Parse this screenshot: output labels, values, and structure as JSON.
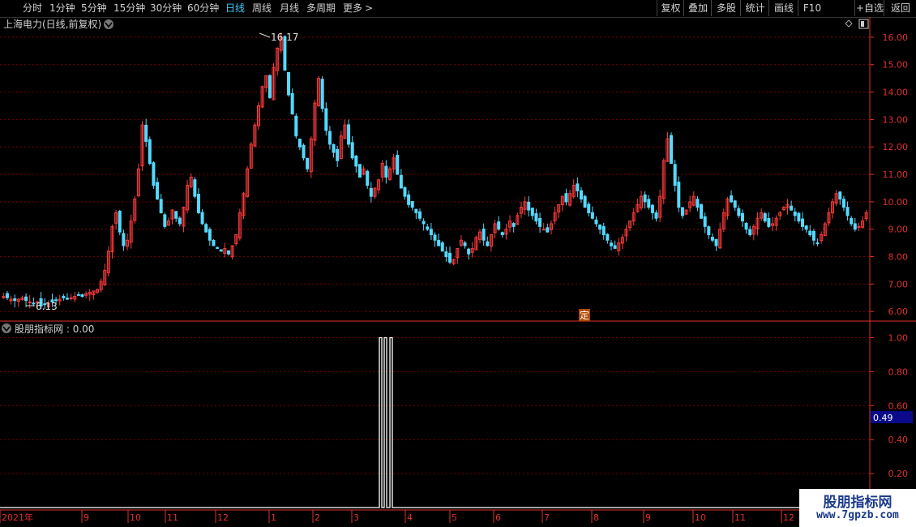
{
  "toolbar": {
    "periods": [
      "分时",
      "1分钟",
      "5分钟",
      "15分钟",
      "30分钟",
      "60分钟",
      "日线",
      "周线",
      "月线",
      "多周期",
      "更多"
    ],
    "active_period": "日线",
    "more_arrow": ">",
    "right_buttons": [
      "复权",
      "叠加",
      "多股",
      "统计",
      "画线",
      "F10",
      "+自选",
      "返回"
    ]
  },
  "main_chart": {
    "title": "上海电力(日线,前复权)",
    "high_label": "16.17",
    "low_label": "6.13",
    "marker_label": "定"
  },
  "indicator": {
    "title": "股朋指标网",
    "value": "0.00",
    "current_value": "0.49"
  },
  "watermark": {
    "title": "股朋指标网",
    "url": "www.7gpzb.com"
  },
  "colors": {
    "up": "#ff3b3b",
    "down": "#54d9ff",
    "grid": "#7a0000",
    "axis_text": "#e03030",
    "month_text": "#e03030",
    "indicator_line": "#ffffff",
    "value_box": "#0a0a8a"
  },
  "chart_data": [
    {
      "type": "candlestick",
      "title": "上海电力(日线,前复权)",
      "yticks": [
        "16.00",
        "15.00",
        "14.00",
        "13.00",
        "12.00",
        "11.00",
        "10.00",
        "9.00",
        "8.00",
        "7.00",
        "6.00"
      ],
      "ylim": [
        5.8,
        16.5
      ],
      "x_months": [
        "2021年",
        "9",
        "10",
        "11",
        "12",
        "1",
        "2",
        "3",
        "4",
        "5",
        "6",
        "7",
        "8",
        "9",
        "10",
        "11",
        "12"
      ],
      "annotations": {
        "max": 16.17,
        "min": 6.13
      },
      "grid": true,
      "closes": [
        6.55,
        6.5,
        6.45,
        6.4,
        6.45,
        6.5,
        6.4,
        6.35,
        6.3,
        6.35,
        6.2,
        6.25,
        6.3,
        6.35,
        6.4,
        6.45,
        6.5,
        6.45,
        6.5,
        6.55,
        6.6,
        6.55,
        6.65,
        6.7,
        6.75,
        6.8,
        7.1,
        7.5,
        8.2,
        9.1,
        9.6,
        8.9,
        8.4,
        8.6,
        9.3,
        10.1,
        11.2,
        12.8,
        12.2,
        11.4,
        10.6,
        10.1,
        9.6,
        9.1,
        9.3,
        9.7,
        9.4,
        9.2,
        9.8,
        10.6,
        10.9,
        10.2,
        9.6,
        9.2,
        8.9,
        8.6,
        8.4,
        8.3,
        8.2,
        8.3,
        8.1,
        8.4,
        8.8,
        9.6,
        10.3,
        11.2,
        12.1,
        12.8,
        13.5,
        14.2,
        14.6,
        13.8,
        14.9,
        15.6,
        16.0,
        14.8,
        13.9,
        13.2,
        12.4,
        12.0,
        11.6,
        11.2,
        12.3,
        13.6,
        14.5,
        13.4,
        12.6,
        12.1,
        11.8,
        11.5,
        12.4,
        12.8,
        12.1,
        11.6,
        11.3,
        10.9,
        11.2,
        10.6,
        10.2,
        10.5,
        10.8,
        11.4,
        10.9,
        11.2,
        11.6,
        11.0,
        10.5,
        10.2,
        9.9,
        9.8,
        9.6,
        9.4,
        9.2,
        9.0,
        8.8,
        8.6,
        8.4,
        8.2,
        8.0,
        7.8,
        7.9,
        8.3,
        8.6,
        8.4,
        8.1,
        8.3,
        8.7,
        8.9,
        8.6,
        8.4,
        8.8,
        9.2,
        9.0,
        8.8,
        9.0,
        9.3,
        9.1,
        9.5,
        9.8,
        10.0,
        9.7,
        9.5,
        9.3,
        9.1,
        9.0,
        8.9,
        9.2,
        9.6,
        9.9,
        10.2,
        10.0,
        10.3,
        10.6,
        10.4,
        10.1,
        9.8,
        9.6,
        9.4,
        9.2,
        9.0,
        8.8,
        8.6,
        8.4,
        8.3,
        8.5,
        8.7,
        9.0,
        9.3,
        9.6,
        9.9,
        10.2,
        10.0,
        9.8,
        9.6,
        9.4,
        10.2,
        11.5,
        12.3,
        11.4,
        10.6,
        9.8,
        9.5,
        9.7,
        10.0,
        10.2,
        9.8,
        9.4,
        9.1,
        8.8,
        8.6,
        8.4,
        9.0,
        9.6,
        10.1,
        10.0,
        9.8,
        9.5,
        9.3,
        9.0,
        8.8,
        9.1,
        9.4,
        9.6,
        9.3,
        9.1,
        9.2,
        9.4,
        9.6,
        9.8,
        9.9,
        9.7,
        9.5,
        9.3,
        9.1,
        9.0,
        8.8,
        8.6,
        8.5,
        8.8,
        9.2,
        9.6,
        10.0,
        10.3,
        10.1,
        9.8,
        9.5,
        9.2,
        9.0,
        9.1,
        9.3,
        9.6
      ]
    },
    {
      "type": "line",
      "title": "股朋指标网",
      "yticks": [
        "1.00",
        "0.80",
        "0.60",
        "0.40",
        "0.20"
      ],
      "ylim": [
        0,
        1.05
      ],
      "current": 0.49,
      "signals": [
        {
          "index": 1,
          "value": 1.0
        },
        {
          "index": 2,
          "value": 1.0
        },
        {
          "index": 3,
          "value": 1.0
        }
      ]
    }
  ]
}
